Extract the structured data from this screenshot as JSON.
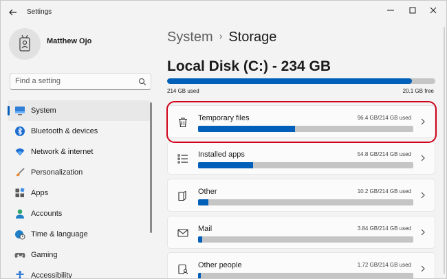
{
  "window": {
    "title": "Settings"
  },
  "profile": {
    "name": "Matthew Ojo"
  },
  "search": {
    "placeholder": "Find a setting"
  },
  "sidebar": {
    "items": [
      {
        "label": "System",
        "icon": "monitor-icon",
        "active": true
      },
      {
        "label": "Bluetooth & devices",
        "icon": "bluetooth-icon"
      },
      {
        "label": "Network & internet",
        "icon": "wifi-icon"
      },
      {
        "label": "Personalization",
        "icon": "brush-icon"
      },
      {
        "label": "Apps",
        "icon": "apps-icon"
      },
      {
        "label": "Accounts",
        "icon": "person-icon"
      },
      {
        "label": "Time & language",
        "icon": "globe-clock-icon"
      },
      {
        "label": "Gaming",
        "icon": "gamepad-icon"
      },
      {
        "label": "Accessibility",
        "icon": "accessibility-icon"
      }
    ]
  },
  "breadcrumb": {
    "parent": "System",
    "separator": "›",
    "current": "Storage"
  },
  "disk": {
    "title": "Local Disk (C:) - 234 GB",
    "used_label": "214 GB used",
    "free_label": "20.1 GB free",
    "used_fraction": 0.914
  },
  "categories": [
    {
      "label": "Temporary files",
      "size": "96.4 GB/214 GB used",
      "fraction": 0.45,
      "icon": "trash-icon",
      "highlighted": true
    },
    {
      "label": "Installed apps",
      "size": "54.8 GB/214 GB used",
      "fraction": 0.256,
      "icon": "list-icon"
    },
    {
      "label": "Other",
      "size": "10.2 GB/214 GB used",
      "fraction": 0.048,
      "icon": "folder-icon"
    },
    {
      "label": "Mail",
      "size": "3.84 GB/214 GB used",
      "fraction": 0.018,
      "icon": "mail-icon"
    },
    {
      "label": "Other people",
      "size": "1.72 GB/214 GB used",
      "fraction": 0.008,
      "icon": "people-icon"
    }
  ],
  "colors": {
    "accent": "#005fb8",
    "highlight": "#d0021b",
    "bar_track": "#c5c5c5"
  }
}
